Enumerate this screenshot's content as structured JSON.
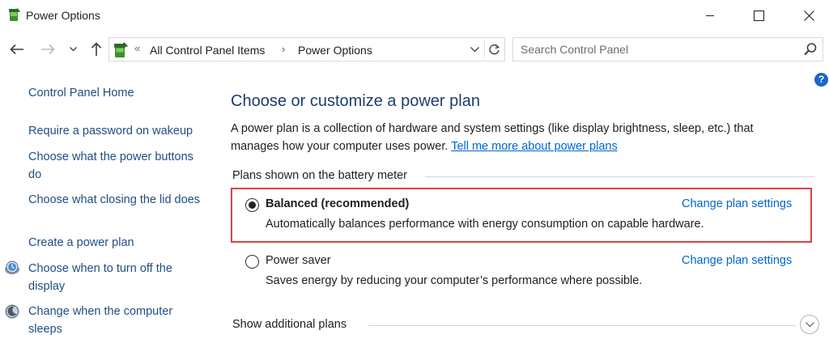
{
  "window": {
    "title": "Power Options",
    "app_icon": "power-options-icon",
    "controls": [
      "minimize-icon",
      "maximize-icon",
      "close-icon"
    ]
  },
  "navigation": {
    "buttons": [
      "back-arrow-icon",
      "forward-arrow-icon",
      "recent-chevron-icon",
      "up-arrow-icon"
    ],
    "breadcrumb_prefix": "«",
    "breadcrumb": [
      "All Control Panel Items",
      "Power Options"
    ],
    "breadcrumb_separator": "›",
    "refresh_icon": "refresh-icon"
  },
  "search": {
    "placeholder": "Search Control Panel",
    "value": ""
  },
  "sidebar": {
    "home": "Control Panel Home",
    "links": [
      "Require a password on wakeup",
      "Choose what the power buttons do",
      "Choose what closing the lid does",
      "Create a power plan",
      "Choose when to turn off the display",
      "Change when the computer sleeps"
    ],
    "icons": [
      "display-timer-icon",
      "sleep-moon-icon"
    ]
  },
  "main": {
    "title": "Choose or customize a power plan",
    "intro": "A power plan is a collection of hardware and system settings (like display brightness, sleep, etc.) that manages how your computer uses power.",
    "intro_link": "Tell me more about power plans",
    "group_label": "Plans shown on the battery meter",
    "plans": [
      {
        "name": "Balanced (recommended)",
        "selected": true,
        "change_link": "Change plan settings",
        "description": "Automatically balances performance with energy consumption on capable hardware."
      },
      {
        "name": "Power saver",
        "selected": false,
        "change_link": "Change plan settings",
        "description": "Saves energy by reducing your computer’s performance where possible."
      }
    ],
    "show_additional": "Show additional plans"
  },
  "colors": {
    "link": "#0066cc",
    "sidebar_link": "#1e4e82",
    "title": "#1b3e6e",
    "highlight_border": "#e04040",
    "help": "#1a66c9"
  }
}
